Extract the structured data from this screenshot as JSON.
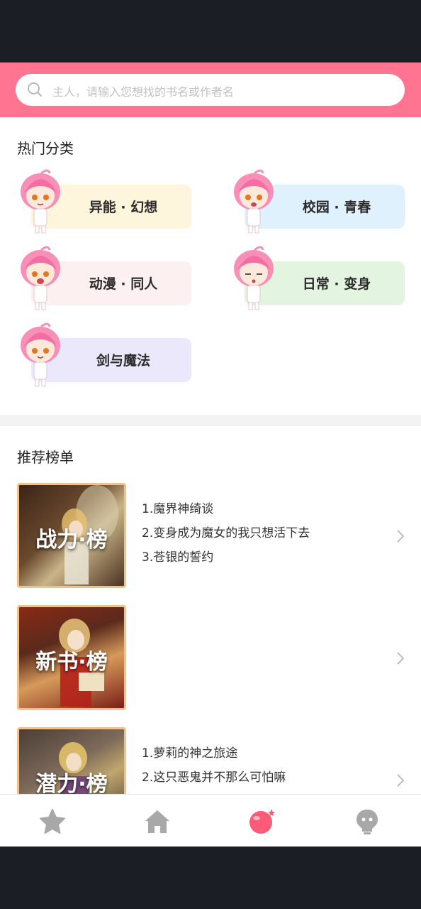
{
  "search": {
    "placeholder": "主人，请输入您想找的书名或作者名"
  },
  "categories": {
    "title": "热门分类",
    "items": [
      {
        "label": "异能 · 幻想",
        "color": "#fdf5dc"
      },
      {
        "label": "校园 · 青春",
        "color": "#dff1fd"
      },
      {
        "label": "动漫 · 同人",
        "color": "#fdf0f1"
      },
      {
        "label": "日常 · 变身",
        "color": "#e3f4e1"
      },
      {
        "label": "剑与魔法",
        "color": "#ebe8fb"
      }
    ]
  },
  "rankings": {
    "title": "推荐榜单",
    "items": [
      {
        "cover": "战力·榜",
        "books": [
          "1.魔界神绮谈",
          "2.变身成为魔女的我只想活下去",
          "3.苍银的誓约"
        ]
      },
      {
        "cover": "新书·榜",
        "books": []
      },
      {
        "cover": "潜力·榜",
        "books": [
          "1.萝莉的神之旅途",
          "2.这只恶鬼并不那么可怕嘛"
        ]
      }
    ]
  },
  "nav": {
    "items": [
      {
        "icon": "star-icon",
        "active": false
      },
      {
        "icon": "home-icon",
        "active": true
      },
      {
        "icon": "ball-icon",
        "active": true
      },
      {
        "icon": "bulb-icon",
        "active": false
      }
    ]
  },
  "colors": {
    "accent": "#ff7591",
    "nav_inactive": "#a8a8a8",
    "cover_border": "#f0c08f"
  }
}
